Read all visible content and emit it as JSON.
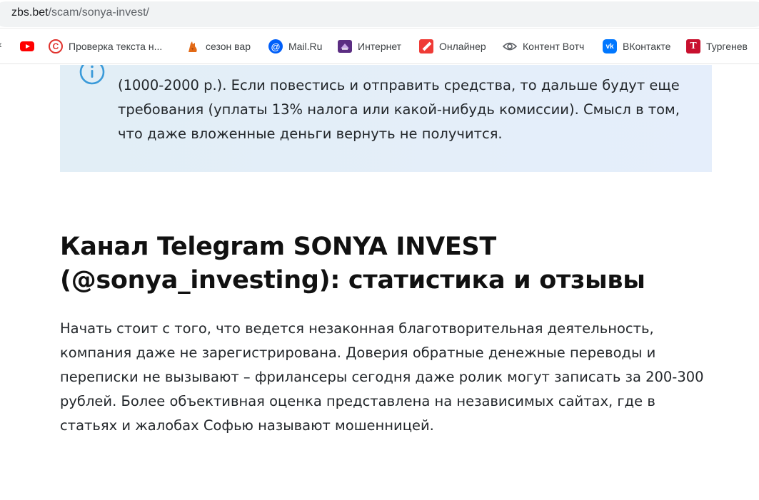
{
  "browser": {
    "url_host": "zbs.bet",
    "url_path": "/scam/sonya-invest/",
    "bookmarks": [
      {
        "label": "",
        "icon": "youtube-icon"
      },
      {
        "label": "Проверка текста н...",
        "icon": "copyright-icon"
      },
      {
        "label": "сезон вар",
        "icon": "fox-icon"
      },
      {
        "label": "Mail.Ru",
        "icon": "mailru-icon"
      },
      {
        "label": "Интернет",
        "icon": "internet-icon"
      },
      {
        "label": "Онлайнер",
        "icon": "onliner-icon"
      },
      {
        "label": "Контент Вотч",
        "icon": "eye-icon"
      },
      {
        "label": "ВКонтакте",
        "icon": "vk-icon"
      },
      {
        "label": "Тургенев",
        "icon": "turgenev-icon"
      }
    ],
    "icon_glyphs": {
      "copyright": "C",
      "mail": "@",
      "vk": "vk",
      "turgenev": "T",
      "chevron": "‹"
    }
  },
  "article": {
    "info_box": {
      "lines": [
        "(1000-2000 р.). Если повестись и отправить средства, то дальше будут еще",
        "требования (уплаты 13% налога или какой-нибудь комиссии). Смысл в том,",
        "что даже вложенные деньги вернуть не получится."
      ]
    },
    "heading_lines": [
      "Канал Telegram SONYA INVEST",
      "(@sonya_investing): статистика и отзывы"
    ],
    "paragraph_lines": [
      "Начать стоит с того, что ведется незаконная благотворительная деятельность,",
      "компания даже не зарегистрирована. Доверия обратные денежные переводы и",
      "переписки не вызывают – фрилансеры сегодня даже ролик могут записать за 200-300",
      "рублей. Более объективная оценка представлена на независимых сайтах, где в",
      "статьях и жалобах Софью называют мошенницей."
    ]
  },
  "colors": {
    "info_box_bg": "#e3eef8",
    "info_icon": "#3a9ad9",
    "text": "#23272b",
    "heading": "#111111"
  }
}
